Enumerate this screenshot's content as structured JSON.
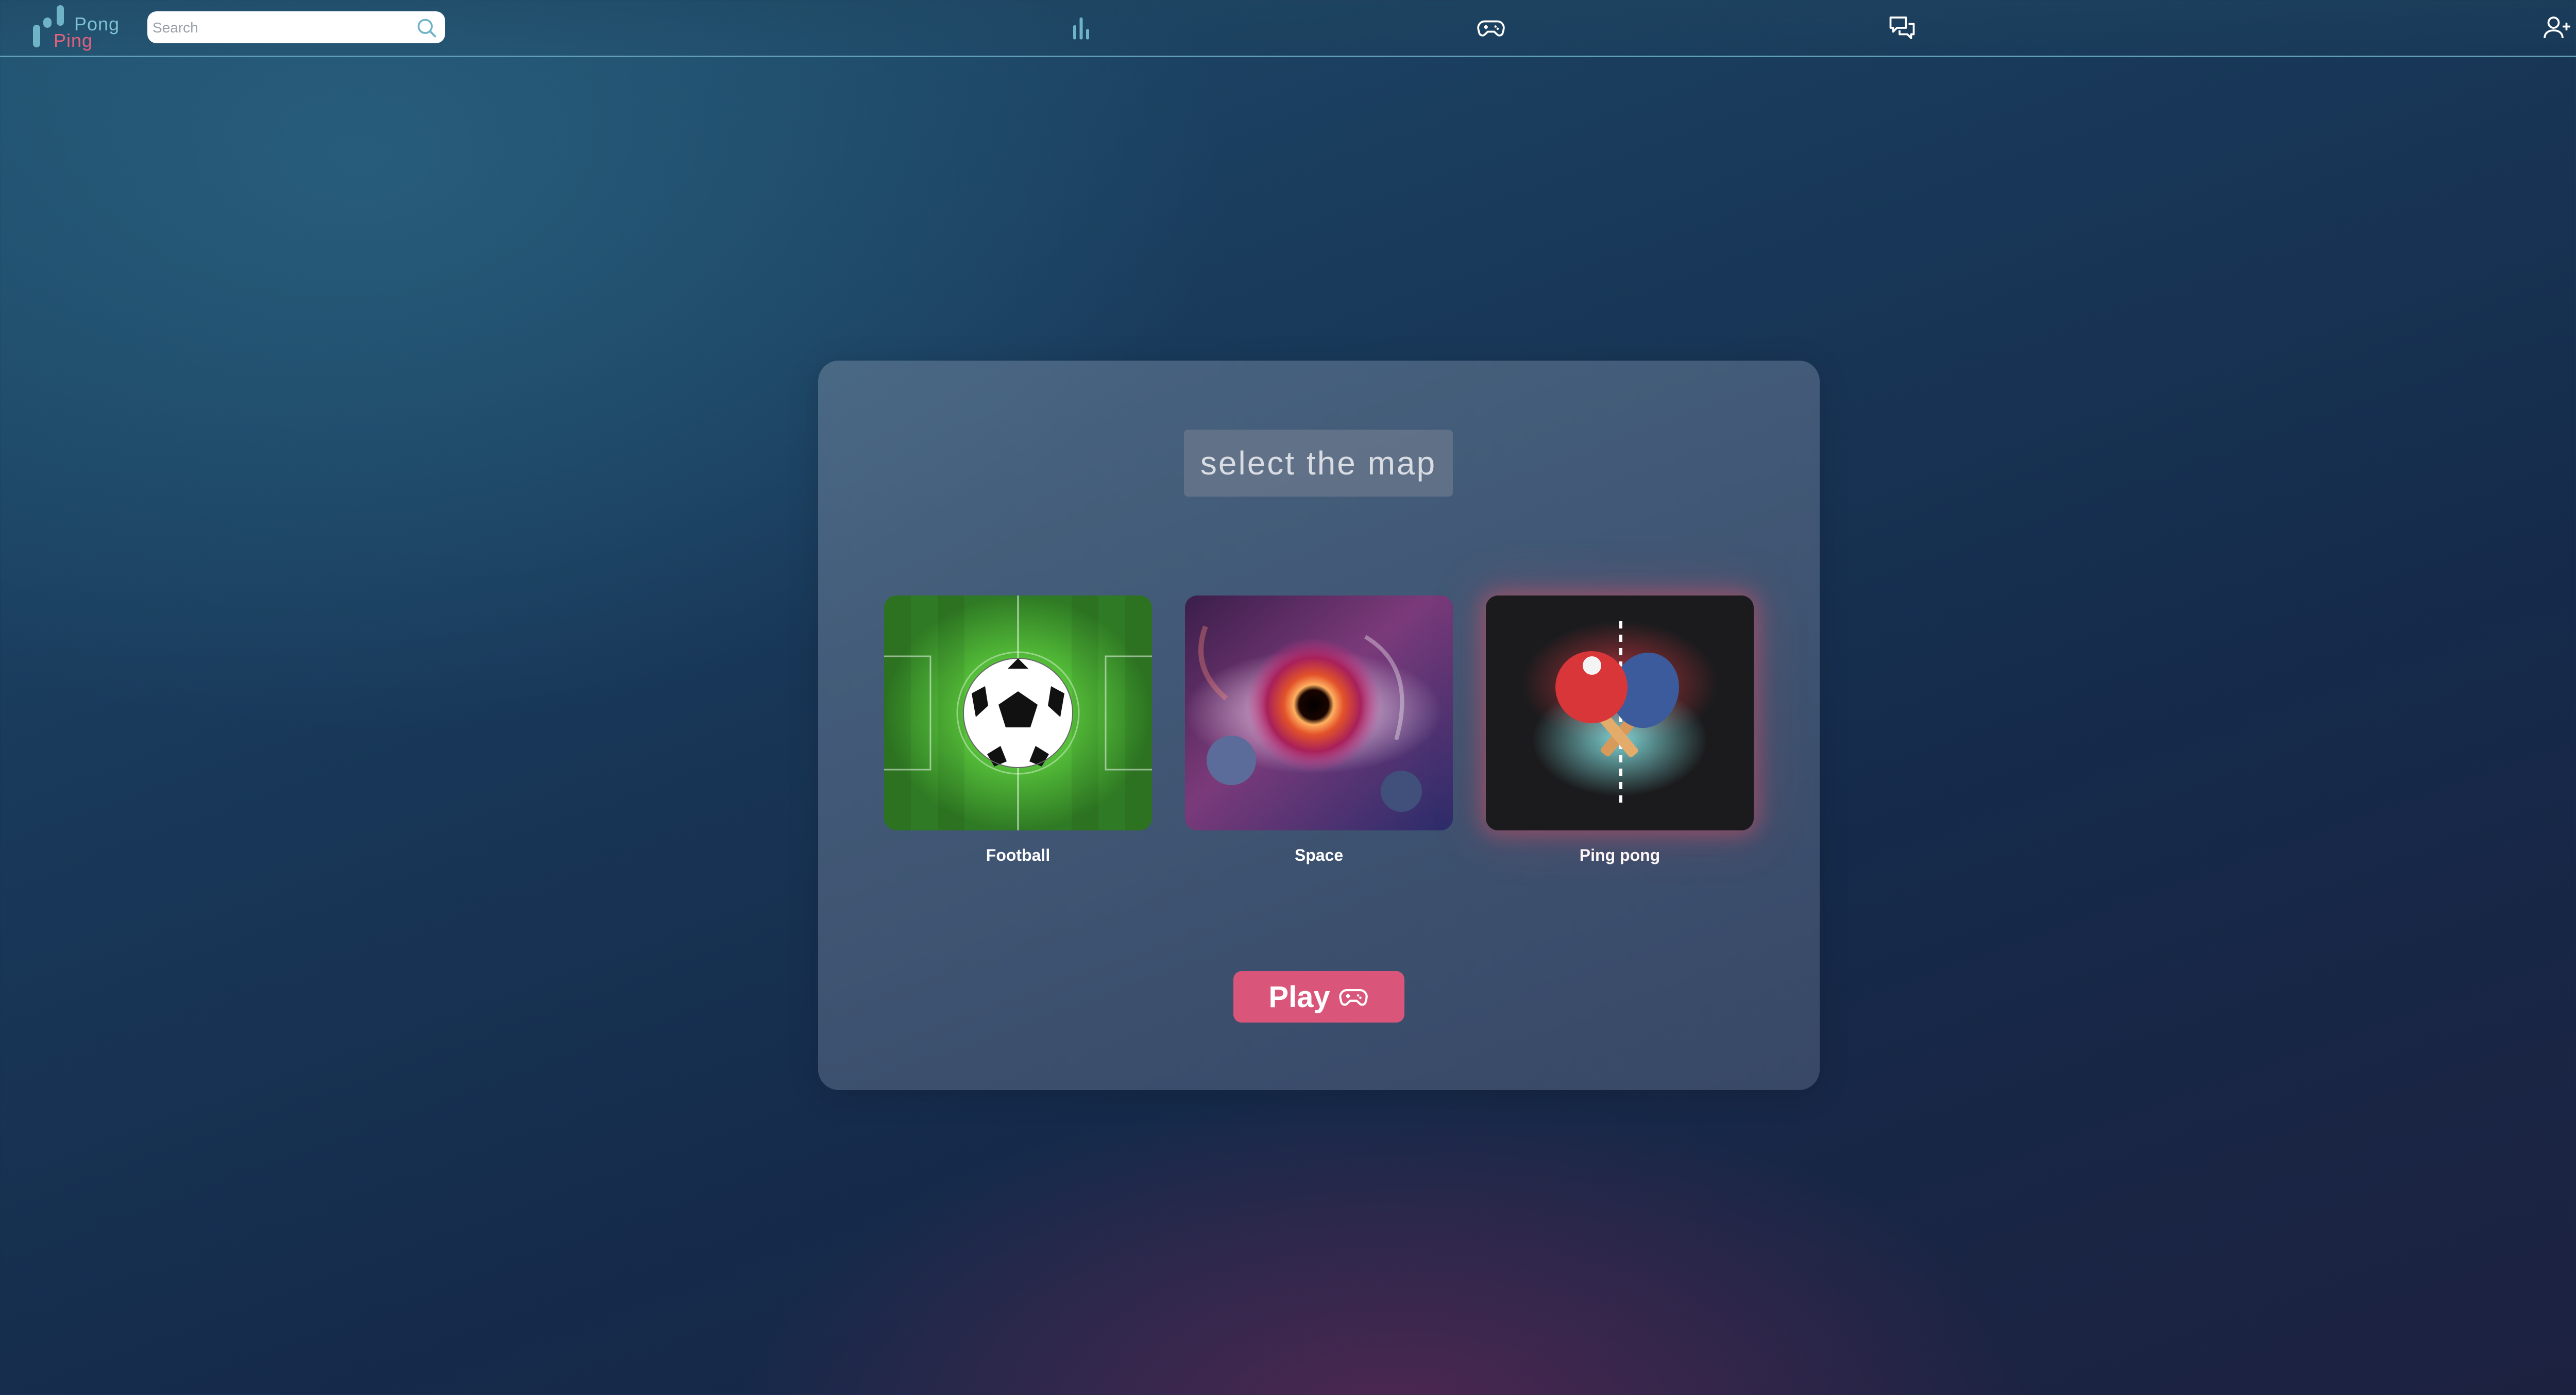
{
  "app": {
    "logo_text_top": "Pong",
    "logo_text_bottom": "Ping",
    "brand_colors": {
      "teal": "#6fb3c6",
      "pink": "#e4607d"
    }
  },
  "header": {
    "search": {
      "placeholder": "Search",
      "value": ""
    },
    "nav_icons": [
      "leaderboard-icon",
      "gamepad-icon",
      "chat-icon"
    ],
    "right_icons": [
      "add-friend-icon",
      "profile-avatar"
    ]
  },
  "modal": {
    "title": "select the map",
    "maps": [
      {
        "label": "Football",
        "icon": "football-pitch-thumbnail",
        "selected": false
      },
      {
        "label": "Space",
        "icon": "space-eye-thumbnail",
        "selected": false
      },
      {
        "label": "Ping pong",
        "icon": "ping-pong-paddles-thumbnail",
        "selected": true
      }
    ],
    "play_label": "Play",
    "play_color": "#d9567a"
  }
}
